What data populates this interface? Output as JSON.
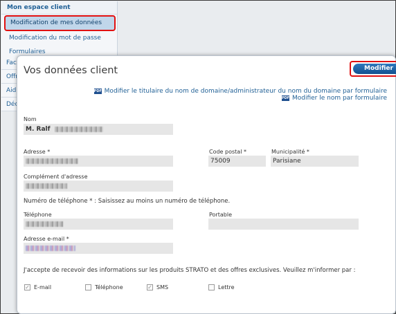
{
  "nav": {
    "header": "Mon espace client",
    "items": [
      {
        "label": "Modification de mes données",
        "active": true
      },
      {
        "label": "Modification du mot de passe",
        "active": false
      },
      {
        "label": "Formulaires",
        "active": false
      }
    ],
    "stubs": [
      "Fac",
      "Offr",
      "Aid",
      "Déc"
    ]
  },
  "panel": {
    "title": "Vos données client",
    "modify_button": "Modifier",
    "links": [
      "Modifier le titulaire du nom de domaine/administrateur du nom du domaine par formulaire",
      "Modifier le nom par formulaire"
    ],
    "pdf_icon_text": "PDF"
  },
  "form": {
    "nom": {
      "label": "Nom",
      "value": "M. Ralf"
    },
    "adresse": {
      "label": "Adresse *"
    },
    "code_postal": {
      "label": "Code postal *",
      "value": "75009"
    },
    "municipalite": {
      "label": "Municipalité *",
      "value": "Parisiane"
    },
    "complement": {
      "label": "Complément d'adresse"
    },
    "phone_note": "Numéro de téléphone * : Saisissez au moins un numéro de téléphone.",
    "telephone": {
      "label": "Téléphone"
    },
    "portable": {
      "label": "Portable",
      "value": ""
    },
    "email": {
      "label": "Adresse e-mail *"
    },
    "consent_text": "J'accepte de recevoir des informations sur les produits STRATO et des offres exclusives. Veuillez m'informer par :",
    "options": [
      {
        "label": "E-mail",
        "checked": true
      },
      {
        "label": "Téléphone",
        "checked": false
      },
      {
        "label": "SMS",
        "checked": true
      },
      {
        "label": "Lettre",
        "checked": false
      }
    ]
  },
  "colors": {
    "accent": "#1f5f95",
    "button": "#1e63a8",
    "highlight": "#e11010"
  }
}
